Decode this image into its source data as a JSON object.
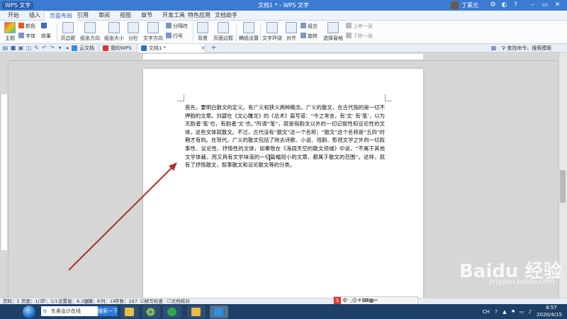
{
  "window": {
    "app_logo": "WPS 文字",
    "title": "文档1 * - WPS 文字",
    "user_name": "丁素光"
  },
  "menu": {
    "tabs": [
      "开始",
      "插入",
      "页面布局",
      "引用",
      "审阅",
      "视图",
      "章节",
      "开发工具",
      "特色应用",
      "文档助手"
    ],
    "active": "页面布局"
  },
  "ribbon": {
    "theme": "主题",
    "color": "颜色",
    "font": "字体",
    "effect": "效果",
    "margins": "页边距",
    "orientation": "纸张方向",
    "size": "纸张大小",
    "columns": "分栏",
    "text_direction": "文字方向",
    "line_numbers": "行号",
    "breaks": "分隔符",
    "background": "背景",
    "page_border": "页面边框",
    "draft_settings": "稿纸设置",
    "wrap_text": "文字环绕",
    "align": "对齐",
    "group": "组合",
    "rotate": "旋转",
    "selection_pane": "选择窗格",
    "bring_forward": "上移一层",
    "send_backward": "下移一层"
  },
  "doc_tabs": [
    {
      "label": "云文档",
      "color": "#2f8fe0"
    },
    {
      "label": "我的WPS",
      "color": "#d23a2c"
    },
    {
      "label": "文档1 *",
      "color": "#2f6fc8"
    }
  ],
  "search": {
    "label": "查找命令、搜索模板"
  },
  "document": {
    "body": "首先，要明白散文的定义。有广义和狭义两种概念。广义的散文，在古代指的是一切不押韵的文章。刘勰在《文心雕龙》的《总术》篇写道：“今之常言，有‘文’ 有‘笔’，以为无韵者‘笔’也，有韵者‘文’也。”所谓“笔”，就是指韵文以外的一切记叙性和议论性的文体，这些文体就散文。不过，古代没有“散文”这一个名称；“散文”这个名称是“五四”时期才有的。在现代，广义的散文包括了除去诗歌、小说、戏剧、影视文学之外的一切叙事性、议论性、抒情性的文体，如秦牧在《海阔天空的散文领域》中说，“不属于其他文学体裁，而又具有文学味道的一切篇幅短小的文章，都属于散文的范围”。这样，就有了抒情散文，叙事散文和议论散文等的分类。"
  },
  "status": {
    "page": "页码：1",
    "pages": "页面：1/1",
    "section": "节：1/1",
    "position": "设置值：6.3厘米",
    "line": "行：8",
    "column": "列：18",
    "word_count": "字数：297",
    "spell_check": "拼写检查",
    "doc_check": "文档校对"
  },
  "ime": {
    "label": "中"
  },
  "taskbar": {
    "search_placeholder": "东奥会计在线",
    "search_button": "搜索一下",
    "time": "8:57",
    "date": "2020/4/15",
    "lang": "CH"
  },
  "watermark": {
    "brand": "Baidu 经验",
    "url": "jingyan.baidu.com"
  },
  "colors": {
    "title_bar": "#3b7bd1",
    "annotation_arrow": "#b0302c",
    "accent": "#1d5bb8"
  }
}
